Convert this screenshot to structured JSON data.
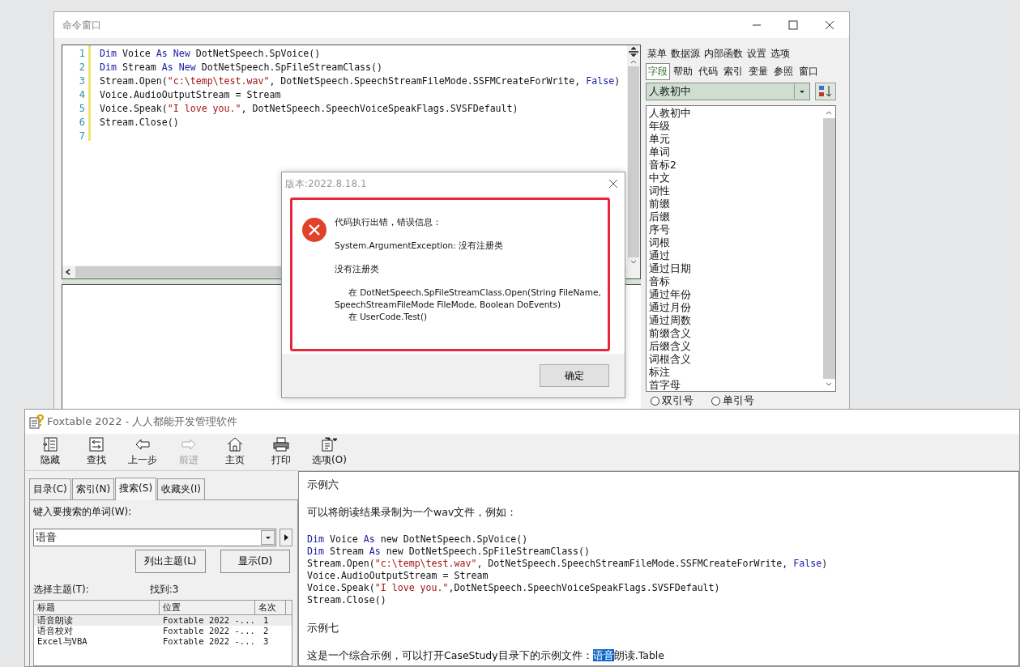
{
  "command_window": {
    "title": "命令窗口",
    "code_lines": [
      {
        "number": "1",
        "tokens": [
          {
            "kind": "kw",
            "text": "Dim"
          },
          {
            "kind": "plain",
            "text": " Voice "
          },
          {
            "kind": "kw",
            "text": "As New"
          },
          {
            "kind": "plain",
            "text": " DotNetSpeech.SpVoice()"
          }
        ]
      },
      {
        "number": "2",
        "tokens": [
          {
            "kind": "kw",
            "text": "Dim"
          },
          {
            "kind": "plain",
            "text": " Stream "
          },
          {
            "kind": "kw",
            "text": "As New"
          },
          {
            "kind": "plain",
            "text": " DotNetSpeech.SpFileStreamClass()"
          }
        ]
      },
      {
        "number": "3",
        "tokens": [
          {
            "kind": "plain",
            "text": "Stream.Open("
          },
          {
            "kind": "str",
            "text": "\"c:\\temp\\test.wav\""
          },
          {
            "kind": "plain",
            "text": ", DotNetSpeech.SpeechStreamFileMode.SSFMCreateForWrite, "
          },
          {
            "kind": "kw",
            "text": "False"
          },
          {
            "kind": "plain",
            "text": ")"
          }
        ]
      },
      {
        "number": "4",
        "tokens": [
          {
            "kind": "plain",
            "text": "Voice.AudioOutputStream = Stream"
          }
        ]
      },
      {
        "number": "5",
        "tokens": [
          {
            "kind": "plain",
            "text": "Voice.Speak("
          },
          {
            "kind": "str",
            "text": "\"I love you.\""
          },
          {
            "kind": "plain",
            "text": ", DotNetSpeech.SpeechVoiceSpeakFlags.SVSFDefault)"
          }
        ]
      },
      {
        "number": "6",
        "tokens": [
          {
            "kind": "plain",
            "text": "Stream.Close()"
          }
        ]
      },
      {
        "number": "7"
      }
    ],
    "menu": [
      "菜单",
      "数据源",
      "内部函数",
      "设置",
      "选项"
    ],
    "tabs": [
      {
        "label": "字段",
        "selected": true
      },
      {
        "label": "帮助",
        "selected": false
      },
      {
        "label": "代码",
        "selected": false
      },
      {
        "label": "索引",
        "selected": false
      },
      {
        "label": "变量",
        "selected": false
      },
      {
        "label": "参照",
        "selected": false
      },
      {
        "label": "窗口",
        "selected": false
      }
    ],
    "table_dropdown": {
      "value": "人教初中"
    },
    "fields": [
      "人教初中",
      "年级",
      "单元",
      "单词",
      "音标2",
      "中文",
      "词性",
      "前缀",
      "后缀",
      "序号",
      "词根",
      "通过",
      "通过日期",
      "音标",
      "通过年份",
      "通过月份",
      "通过周数",
      "前缀含义",
      "后缀含义",
      "词根含义",
      "标注",
      "首字母"
    ],
    "quote_options": [
      {
        "label": "双引号",
        "selected": false
      },
      {
        "label": "单引号",
        "selected": false
      }
    ]
  },
  "error_dialog": {
    "title": "版本:2022.8.18.1",
    "paragraphs": [
      [
        "代码执行出错，错误信息："
      ],
      [
        "System.ArgumentException: 没有注册类"
      ],
      [
        "没有注册类"
      ],
      [
        "在 DotNetSpeech.SpFileStreamClass.Open(String FileName, SpeechStreamFileMode FileMode, Boolean DoEvents)",
        "在 UserCode.Test()"
      ]
    ],
    "button": "确定"
  },
  "help_window": {
    "title": "Foxtable 2022 - 人人都能开发管理软件",
    "toolbar": [
      {
        "label": "隐藏",
        "disabled": false
      },
      {
        "label": "查找",
        "disabled": false
      },
      {
        "label": "上一步",
        "disabled": false
      },
      {
        "label": "前进",
        "disabled": true
      },
      {
        "label": "主页",
        "disabled": false
      },
      {
        "label": "打印",
        "disabled": false
      },
      {
        "label": "选项(O)",
        "disabled": false
      }
    ],
    "tabs": [
      {
        "label": "目录(C)",
        "selected": false
      },
      {
        "label": "索引(N)",
        "selected": false
      },
      {
        "label": "搜索(S)",
        "selected": true
      },
      {
        "label": "收藏夹(I)",
        "selected": false
      }
    ],
    "search_label": "键入要搜索的单词(W):",
    "search_value": "语音",
    "buttons": [
      "列出主题(L)",
      "显示(D)"
    ],
    "topics_label": "选择主题(T):",
    "found": "找到:3",
    "columns": [
      "标题",
      "位置",
      "名次"
    ],
    "rows": [
      {
        "cells": [
          "语音朗读",
          "Foxtable 2022 -...",
          "1"
        ],
        "selected": true
      },
      {
        "cells": [
          "语音校对",
          "Foxtable 2022 -...",
          "2"
        ],
        "selected": false
      },
      {
        "cells": [
          "Excel与VBA",
          "Foxtable 2022 -...",
          "3"
        ],
        "selected": false
      }
    ],
    "content": [
      {
        "kind": "text",
        "parts": [
          {
            "text": "示例六",
            "highlight": false
          }
        ]
      },
      {
        "kind": "text",
        "parts": [
          {
            "text": "可以将朗读结果录制为一个wav文件，例如：",
            "highlight": false
          }
        ]
      },
      {
        "kind": "code",
        "lines": [
          [
            {
              "kind": "kw",
              "text": "Dim"
            },
            {
              "kind": "plain",
              "text": " Voice "
            },
            {
              "kind": "kw",
              "text": "As"
            },
            {
              "kind": "plain",
              "text": " new DotNetSpeech.SpVoice()"
            }
          ],
          [
            {
              "kind": "kw",
              "text": "Dim"
            },
            {
              "kind": "plain",
              "text": " Stream "
            },
            {
              "kind": "kw",
              "text": "As"
            },
            {
              "kind": "plain",
              "text": " new DotNetSpeech.SpFileStreamClass()"
            }
          ],
          [
            {
              "kind": "plain",
              "text": "Stream.Open("
            },
            {
              "kind": "str",
              "text": "\"c:\\temp\\test.wav\""
            },
            {
              "kind": "plain",
              "text": ", DotNetSpeech.SpeechStreamFileMode.SSFMCreateForWrite, "
            },
            {
              "kind": "kw",
              "text": "False"
            },
            {
              "kind": "plain",
              "text": ")"
            }
          ],
          [
            {
              "kind": "plain",
              "text": "Voice.AudioOutputStream = Stream"
            }
          ],
          [
            {
              "kind": "plain",
              "text": "Voice.Speak("
            },
            {
              "kind": "str",
              "text": "\"I love you.\""
            },
            {
              "kind": "plain",
              "text": ",DotNetSpeech.SpeechVoiceSpeakFlags.SVSFDefault)"
            }
          ],
          [
            {
              "kind": "plain",
              "text": "Stream.Close()"
            }
          ]
        ]
      },
      {
        "kind": "text",
        "parts": [
          {
            "text": "示例七",
            "highlight": false
          }
        ]
      },
      {
        "kind": "text",
        "parts": [
          {
            "text": "这是一个综合示例，可以打开CaseStudy目录下的示例文件：",
            "highlight": false
          },
          {
            "text": "语音",
            "highlight": true
          },
          {
            "text": "朗读.Table",
            "highlight": false
          }
        ]
      }
    ]
  }
}
